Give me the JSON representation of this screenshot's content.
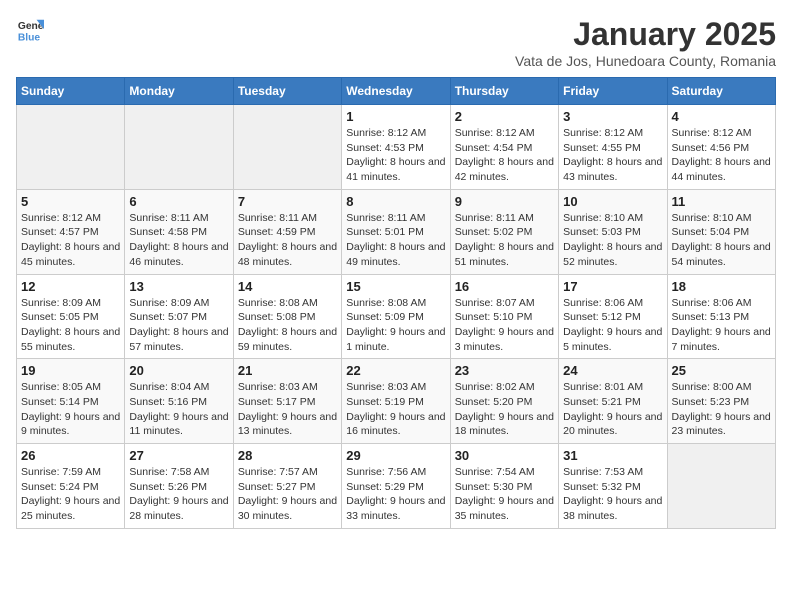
{
  "logo": {
    "text_general": "General",
    "text_blue": "Blue"
  },
  "title": "January 2025",
  "subtitle": "Vata de Jos, Hunedoara County, Romania",
  "days_of_week": [
    "Sunday",
    "Monday",
    "Tuesday",
    "Wednesday",
    "Thursday",
    "Friday",
    "Saturday"
  ],
  "weeks": [
    [
      {
        "day": null
      },
      {
        "day": null
      },
      {
        "day": null
      },
      {
        "day": "1",
        "sunrise": "Sunrise: 8:12 AM",
        "sunset": "Sunset: 4:53 PM",
        "daylight": "Daylight: 8 hours and 41 minutes."
      },
      {
        "day": "2",
        "sunrise": "Sunrise: 8:12 AM",
        "sunset": "Sunset: 4:54 PM",
        "daylight": "Daylight: 8 hours and 42 minutes."
      },
      {
        "day": "3",
        "sunrise": "Sunrise: 8:12 AM",
        "sunset": "Sunset: 4:55 PM",
        "daylight": "Daylight: 8 hours and 43 minutes."
      },
      {
        "day": "4",
        "sunrise": "Sunrise: 8:12 AM",
        "sunset": "Sunset: 4:56 PM",
        "daylight": "Daylight: 8 hours and 44 minutes."
      }
    ],
    [
      {
        "day": "5",
        "sunrise": "Sunrise: 8:12 AM",
        "sunset": "Sunset: 4:57 PM",
        "daylight": "Daylight: 8 hours and 45 minutes."
      },
      {
        "day": "6",
        "sunrise": "Sunrise: 8:11 AM",
        "sunset": "Sunset: 4:58 PM",
        "daylight": "Daylight: 8 hours and 46 minutes."
      },
      {
        "day": "7",
        "sunrise": "Sunrise: 8:11 AM",
        "sunset": "Sunset: 4:59 PM",
        "daylight": "Daylight: 8 hours and 48 minutes."
      },
      {
        "day": "8",
        "sunrise": "Sunrise: 8:11 AM",
        "sunset": "Sunset: 5:01 PM",
        "daylight": "Daylight: 8 hours and 49 minutes."
      },
      {
        "day": "9",
        "sunrise": "Sunrise: 8:11 AM",
        "sunset": "Sunset: 5:02 PM",
        "daylight": "Daylight: 8 hours and 51 minutes."
      },
      {
        "day": "10",
        "sunrise": "Sunrise: 8:10 AM",
        "sunset": "Sunset: 5:03 PM",
        "daylight": "Daylight: 8 hours and 52 minutes."
      },
      {
        "day": "11",
        "sunrise": "Sunrise: 8:10 AM",
        "sunset": "Sunset: 5:04 PM",
        "daylight": "Daylight: 8 hours and 54 minutes."
      }
    ],
    [
      {
        "day": "12",
        "sunrise": "Sunrise: 8:09 AM",
        "sunset": "Sunset: 5:05 PM",
        "daylight": "Daylight: 8 hours and 55 minutes."
      },
      {
        "day": "13",
        "sunrise": "Sunrise: 8:09 AM",
        "sunset": "Sunset: 5:07 PM",
        "daylight": "Daylight: 8 hours and 57 minutes."
      },
      {
        "day": "14",
        "sunrise": "Sunrise: 8:08 AM",
        "sunset": "Sunset: 5:08 PM",
        "daylight": "Daylight: 8 hours and 59 minutes."
      },
      {
        "day": "15",
        "sunrise": "Sunrise: 8:08 AM",
        "sunset": "Sunset: 5:09 PM",
        "daylight": "Daylight: 9 hours and 1 minute."
      },
      {
        "day": "16",
        "sunrise": "Sunrise: 8:07 AM",
        "sunset": "Sunset: 5:10 PM",
        "daylight": "Daylight: 9 hours and 3 minutes."
      },
      {
        "day": "17",
        "sunrise": "Sunrise: 8:06 AM",
        "sunset": "Sunset: 5:12 PM",
        "daylight": "Daylight: 9 hours and 5 minutes."
      },
      {
        "day": "18",
        "sunrise": "Sunrise: 8:06 AM",
        "sunset": "Sunset: 5:13 PM",
        "daylight": "Daylight: 9 hours and 7 minutes."
      }
    ],
    [
      {
        "day": "19",
        "sunrise": "Sunrise: 8:05 AM",
        "sunset": "Sunset: 5:14 PM",
        "daylight": "Daylight: 9 hours and 9 minutes."
      },
      {
        "day": "20",
        "sunrise": "Sunrise: 8:04 AM",
        "sunset": "Sunset: 5:16 PM",
        "daylight": "Daylight: 9 hours and 11 minutes."
      },
      {
        "day": "21",
        "sunrise": "Sunrise: 8:03 AM",
        "sunset": "Sunset: 5:17 PM",
        "daylight": "Daylight: 9 hours and 13 minutes."
      },
      {
        "day": "22",
        "sunrise": "Sunrise: 8:03 AM",
        "sunset": "Sunset: 5:19 PM",
        "daylight": "Daylight: 9 hours and 16 minutes."
      },
      {
        "day": "23",
        "sunrise": "Sunrise: 8:02 AM",
        "sunset": "Sunset: 5:20 PM",
        "daylight": "Daylight: 9 hours and 18 minutes."
      },
      {
        "day": "24",
        "sunrise": "Sunrise: 8:01 AM",
        "sunset": "Sunset: 5:21 PM",
        "daylight": "Daylight: 9 hours and 20 minutes."
      },
      {
        "day": "25",
        "sunrise": "Sunrise: 8:00 AM",
        "sunset": "Sunset: 5:23 PM",
        "daylight": "Daylight: 9 hours and 23 minutes."
      }
    ],
    [
      {
        "day": "26",
        "sunrise": "Sunrise: 7:59 AM",
        "sunset": "Sunset: 5:24 PM",
        "daylight": "Daylight: 9 hours and 25 minutes."
      },
      {
        "day": "27",
        "sunrise": "Sunrise: 7:58 AM",
        "sunset": "Sunset: 5:26 PM",
        "daylight": "Daylight: 9 hours and 28 minutes."
      },
      {
        "day": "28",
        "sunrise": "Sunrise: 7:57 AM",
        "sunset": "Sunset: 5:27 PM",
        "daylight": "Daylight: 9 hours and 30 minutes."
      },
      {
        "day": "29",
        "sunrise": "Sunrise: 7:56 AM",
        "sunset": "Sunset: 5:29 PM",
        "daylight": "Daylight: 9 hours and 33 minutes."
      },
      {
        "day": "30",
        "sunrise": "Sunrise: 7:54 AM",
        "sunset": "Sunset: 5:30 PM",
        "daylight": "Daylight: 9 hours and 35 minutes."
      },
      {
        "day": "31",
        "sunrise": "Sunrise: 7:53 AM",
        "sunset": "Sunset: 5:32 PM",
        "daylight": "Daylight: 9 hours and 38 minutes."
      },
      {
        "day": null
      }
    ]
  ]
}
